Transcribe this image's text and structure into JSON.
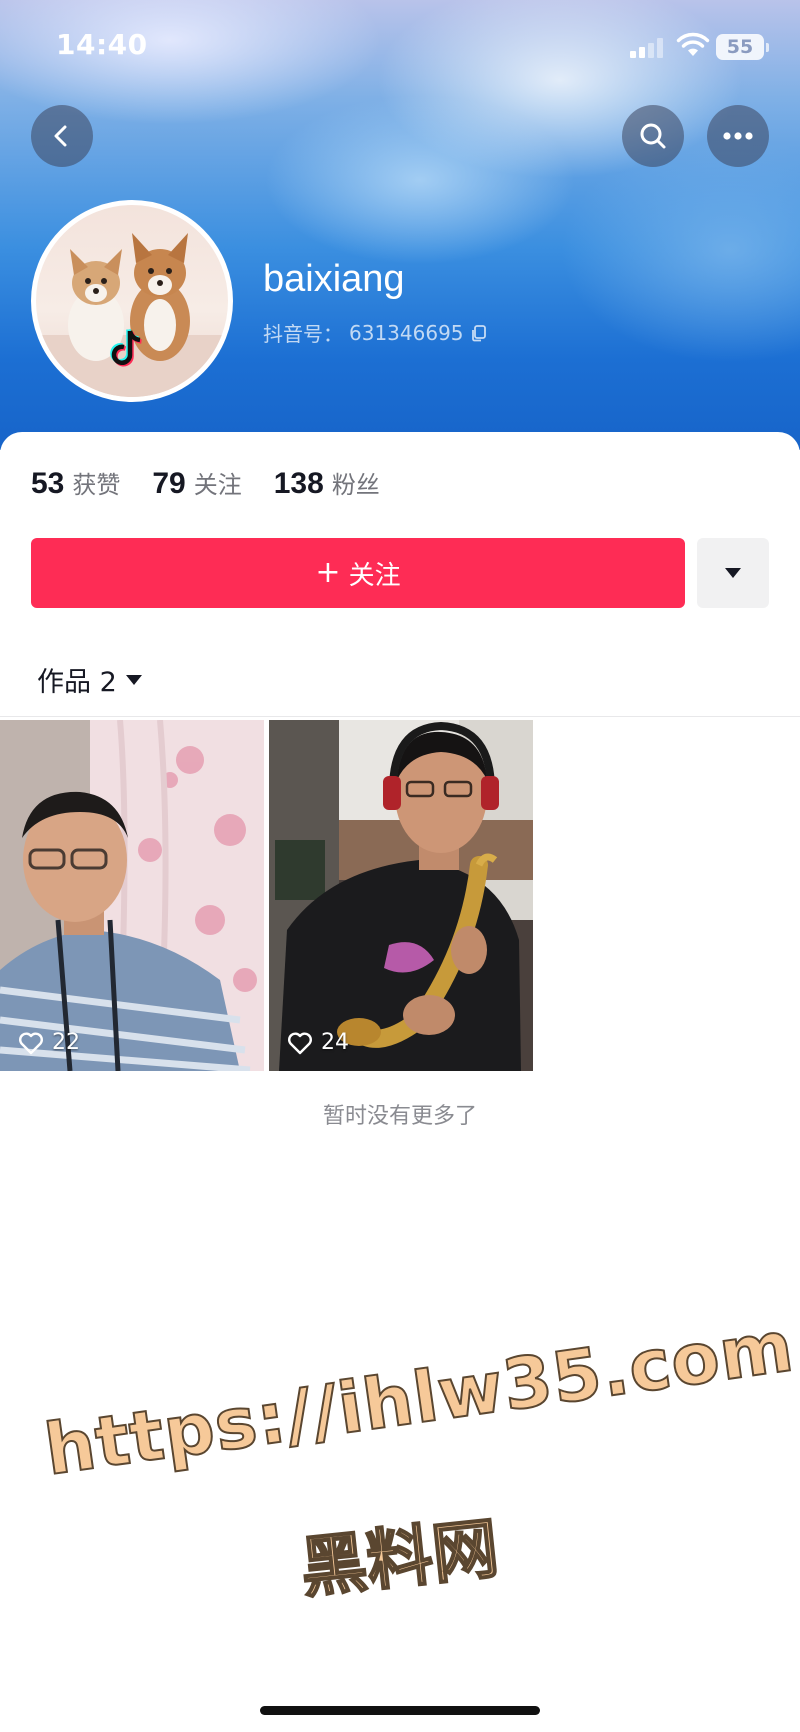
{
  "status_bar": {
    "time": "14:40",
    "battery": "55"
  },
  "profile": {
    "username": "baixiang",
    "douyin_id_label": "抖音号：",
    "douyin_id": "631346695"
  },
  "stats": [
    {
      "value": "53",
      "label": "获赞"
    },
    {
      "value": "79",
      "label": "关注"
    },
    {
      "value": "138",
      "label": "粉丝"
    }
  ],
  "follow_button": {
    "icon": "+",
    "label": "关注"
  },
  "tabs": {
    "works_label": "作品 2"
  },
  "videos": [
    {
      "likes": "22"
    },
    {
      "likes": "24"
    }
  ],
  "footer_text": "暂时没有更多了",
  "watermark": {
    "line1": "https://ihlw35.com",
    "line2": "黑料网"
  },
  "colors": {
    "accent": "#fe2c55",
    "header_blue": "#1c6fd3",
    "watermark_fill": "#f6c999"
  },
  "icons": [
    "back-chevron-icon",
    "search-icon",
    "more-dots-icon",
    "copy-icon",
    "caret-down-icon",
    "heart-icon",
    "tiktok-logo-icon",
    "wifi-icon",
    "signal-icon",
    "battery-icon"
  ]
}
